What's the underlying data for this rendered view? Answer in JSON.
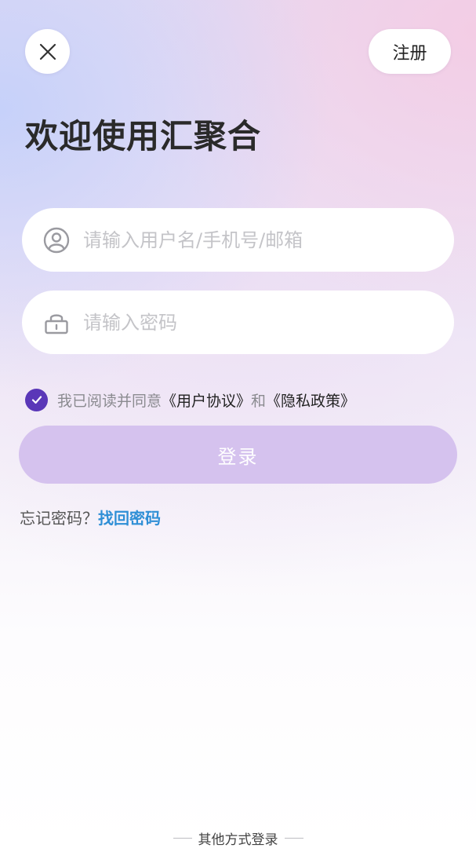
{
  "header": {
    "close_icon": "close-icon",
    "register_label": "注册"
  },
  "title": "欢迎使用汇聚合",
  "form": {
    "username": {
      "icon": "user-icon",
      "placeholder": "请输入用户名/手机号/邮箱",
      "value": ""
    },
    "password": {
      "icon": "lock-icon",
      "placeholder": "请输入密码",
      "value": ""
    },
    "agreement": {
      "checked": true,
      "prefix": "我已阅读并同意",
      "user_agreement": "《用户协议》",
      "conjunction": "和",
      "privacy_policy": "《隐私政策》"
    },
    "login_label": "登录"
  },
  "forgot": {
    "question": "忘记密码？",
    "link": "找回密码"
  },
  "other_login_label": "其他方式登录",
  "colors": {
    "accent": "#5a37b8",
    "login_button": "#d5c2ee",
    "link_blue": "#2f8fd6"
  }
}
